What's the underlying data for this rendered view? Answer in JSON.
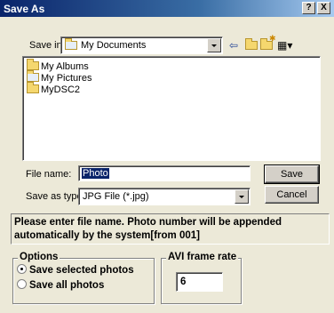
{
  "window": {
    "title": "Save As",
    "help_label": "?",
    "close_label": "X"
  },
  "toolbar": {
    "save_in_label": "Save in:",
    "save_in_value": "My Documents",
    "back_icon": "back-arrow-icon",
    "up_icon": "up-folder-icon",
    "new_folder_icon": "new-folder-icon",
    "views_icon": "view-menu-icon"
  },
  "files": [
    {
      "name": "My Albums",
      "icon": "folder-icon"
    },
    {
      "name": "My Pictures",
      "icon": "pictures-folder-icon"
    },
    {
      "name": "MyDSC2",
      "icon": "folder-icon"
    }
  ],
  "form": {
    "file_name_label": "File name:",
    "file_name_value": "Photo",
    "save_as_type_label": "Save as type:",
    "save_as_type_value": "JPG File (*.jpg)",
    "save_button": "Save",
    "cancel_button": "Cancel"
  },
  "message": "Please enter file name. Photo number will be appended automatically by the system[from 001]",
  "options": {
    "title": "Options",
    "choices": [
      {
        "label": "Save selected photos",
        "selected": true
      },
      {
        "label": "Save all photos",
        "selected": false
      }
    ]
  },
  "avi": {
    "title": "AVI frame rate",
    "value": "6"
  },
  "colors": {
    "title_bar": "#0a246a",
    "selection": "#0a246a",
    "face": "#ece9d8"
  }
}
